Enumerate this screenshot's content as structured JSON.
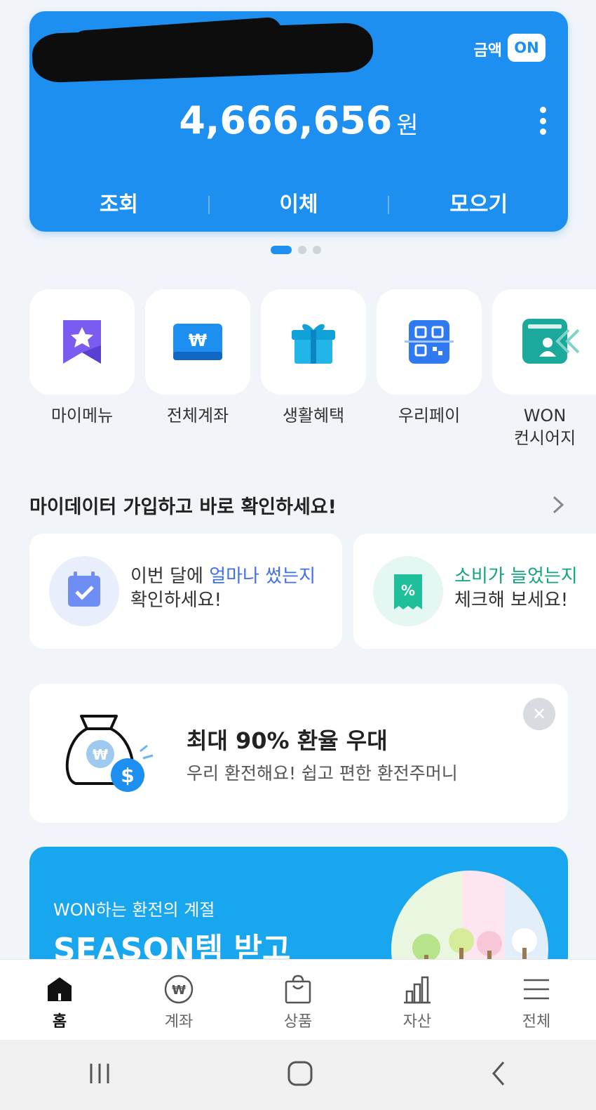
{
  "account": {
    "toggle_label": "금액",
    "toggle_state": "ON",
    "balance": "4,666,656",
    "currency": "원",
    "actions": [
      "조회",
      "이체",
      "모으기"
    ]
  },
  "quick_menu": [
    {
      "label": "마이메뉴",
      "icon": "star-bookmark-icon"
    },
    {
      "label": "전체계좌",
      "icon": "won-wallet-icon"
    },
    {
      "label": "생활혜택",
      "icon": "gift-icon"
    },
    {
      "label": "우리페이",
      "icon": "qr-pay-icon"
    },
    {
      "label": "WON\n컨시어지",
      "line1": "WON",
      "line2": "컨시어지",
      "icon": "concierge-icon"
    }
  ],
  "mydata": {
    "title": "마이데이터 가입하고 바로 확인하세요!",
    "cards": [
      {
        "pre": "이번 달에 ",
        "highlight": "얼마나 썼는지",
        "line2": "확인하세요!",
        "highlight_color": "#3f6ff0"
      },
      {
        "pre": "",
        "highlight": "소비가 늘었는지",
        "line2": "체크해 보세요!",
        "highlight_color": "#13a383"
      }
    ]
  },
  "promo": {
    "title": "최대 90% 환율 우대",
    "subtitle": "우리 환전해요! 쉽고 편한 환전주머니"
  },
  "banner": {
    "kicker": "WON하는 환전의 계절",
    "headline": "SEASON템 받고"
  },
  "bottom_nav": [
    {
      "label": "홈",
      "active": true
    },
    {
      "label": "계좌",
      "active": false
    },
    {
      "label": "상품",
      "active": false
    },
    {
      "label": "자산",
      "active": false
    },
    {
      "label": "전체",
      "active": false
    }
  ],
  "colors": {
    "brand_blue": "#1d8ff0",
    "background": "#f1f4f8",
    "banner_blue": "#18a6ee"
  }
}
